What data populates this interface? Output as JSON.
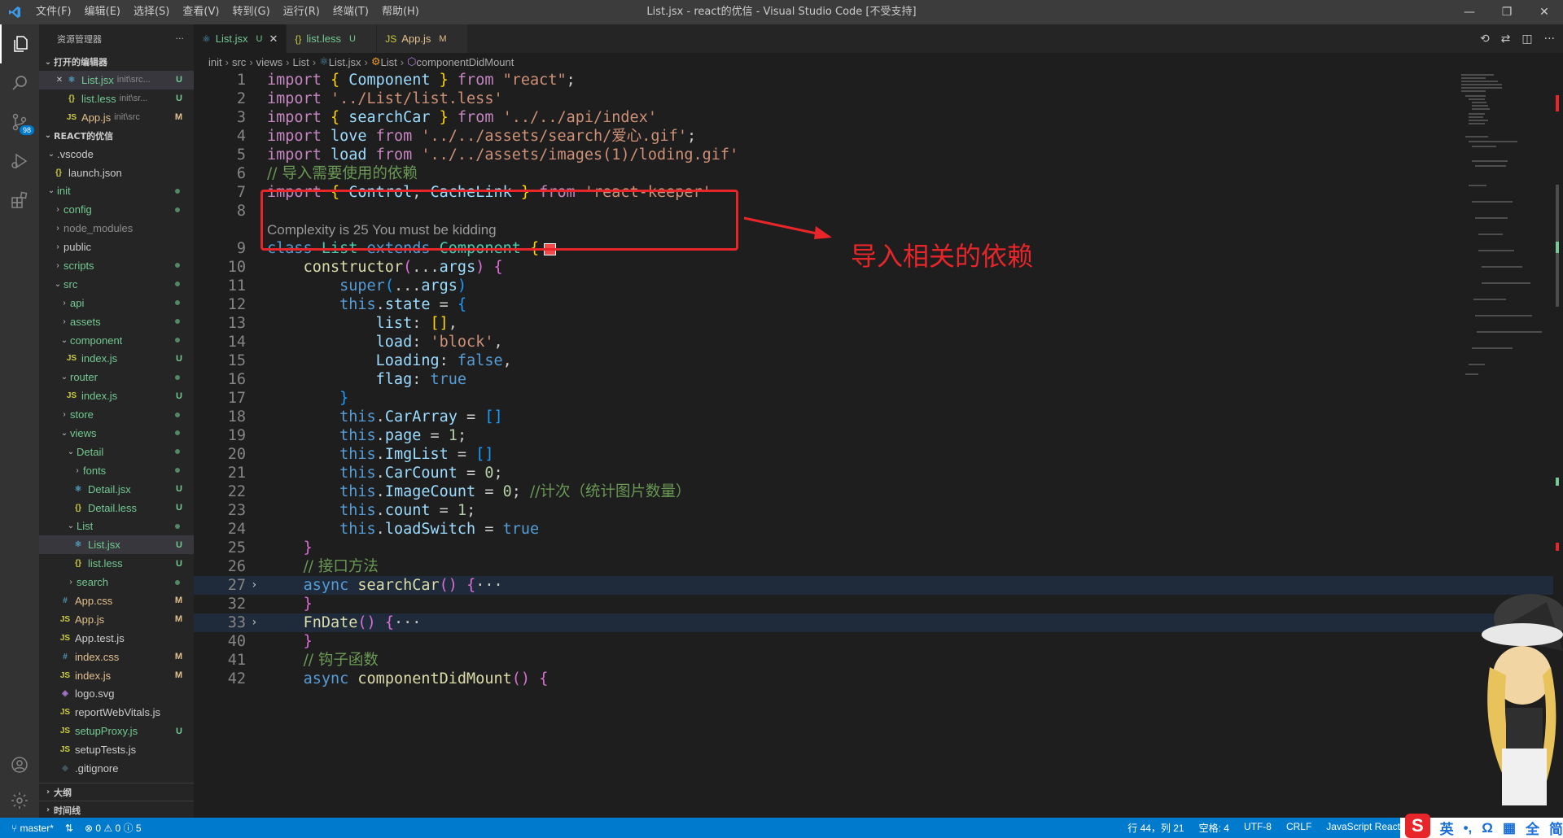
{
  "titlebar": {
    "title": "List.jsx - react的优信 - Visual Studio Code [不受支持]",
    "menu": [
      "文件(F)",
      "编辑(E)",
      "选择(S)",
      "查看(V)",
      "转到(G)",
      "运行(R)",
      "终端(T)",
      "帮助(H)"
    ],
    "minimize": "—",
    "maximize": "❐",
    "close": "✕"
  },
  "activity": {
    "scm_badge": "98"
  },
  "sidebar": {
    "header": "资源管理器",
    "more": "···",
    "open_editors_label": "打开的编辑器",
    "open_editors": [
      {
        "name": "List.jsx",
        "desc": "init\\src...",
        "status": "U",
        "icon": "⚛",
        "close": "✕"
      },
      {
        "name": "list.less",
        "desc": "init\\sr...",
        "status": "U",
        "icon": "{}"
      },
      {
        "name": "App.js",
        "desc": "init\\src",
        "status": "M",
        "icon": "JS"
      }
    ],
    "project_label": "REACT的优信",
    "tree": [
      {
        "name": ".vscode",
        "chev": "⌄",
        "depth": 1
      },
      {
        "name": "launch.json",
        "icon": "{}",
        "depth": 1
      },
      {
        "name": "init",
        "chev": "⌄",
        "depth": 1,
        "dot": true
      },
      {
        "name": "config",
        "chev": "›",
        "depth": 2,
        "dot": true
      },
      {
        "name": "node_modules",
        "chev": "›",
        "depth": 2,
        "gray": true
      },
      {
        "name": "public",
        "chev": "›",
        "depth": 2
      },
      {
        "name": "scripts",
        "chev": "›",
        "depth": 2,
        "dot": true
      },
      {
        "name": "src",
        "chev": "⌄",
        "depth": 2,
        "dot": true
      },
      {
        "name": "api",
        "chev": "›",
        "depth": 3,
        "dot": true
      },
      {
        "name": "assets",
        "chev": "›",
        "depth": 3,
        "dot": true
      },
      {
        "name": "component",
        "chev": "⌄",
        "depth": 3,
        "dot": true
      },
      {
        "name": "index.js",
        "icon": "JS",
        "depth": 3,
        "status": "U"
      },
      {
        "name": "router",
        "chev": "⌄",
        "depth": 3,
        "dot": true
      },
      {
        "name": "index.js",
        "icon": "JS",
        "depth": 3,
        "status": "U"
      },
      {
        "name": "store",
        "chev": "›",
        "depth": 3,
        "dot": true
      },
      {
        "name": "views",
        "chev": "⌄",
        "depth": 3,
        "dot": true
      },
      {
        "name": "Detail",
        "chev": "⌄",
        "depth": 4,
        "dot": true
      },
      {
        "name": "fonts",
        "chev": "›",
        "depth": 5,
        "dot": true
      },
      {
        "name": "Detail.jsx",
        "icon": "⚛",
        "depth": 4,
        "status": "U"
      },
      {
        "name": "Detail.less",
        "icon": "{}",
        "depth": 4,
        "status": "U"
      },
      {
        "name": "List",
        "chev": "⌄",
        "depth": 4,
        "dot": true
      },
      {
        "name": "List.jsx",
        "icon": "⚛",
        "depth": 4,
        "status": "U",
        "selected": true
      },
      {
        "name": "list.less",
        "icon": "{}",
        "depth": 4,
        "status": "U"
      },
      {
        "name": "search",
        "chev": "›",
        "depth": 4,
        "dot": true
      },
      {
        "name": "App.css",
        "icon": "#",
        "depth": 2,
        "status": "M"
      },
      {
        "name": "App.js",
        "icon": "JS",
        "depth": 2,
        "status": "M"
      },
      {
        "name": "App.test.js",
        "icon": "JS",
        "depth": 2
      },
      {
        "name": "index.css",
        "icon": "#",
        "depth": 2,
        "status": "M"
      },
      {
        "name": "index.js",
        "icon": "JS",
        "depth": 2,
        "status": "M"
      },
      {
        "name": "logo.svg",
        "icon": "◈",
        "depth": 2
      },
      {
        "name": "reportWebVitals.js",
        "icon": "JS",
        "depth": 2
      },
      {
        "name": "setupProxy.js",
        "icon": "JS",
        "depth": 2,
        "status": "U"
      },
      {
        "name": "setupTests.js",
        "icon": "JS",
        "depth": 2
      },
      {
        "name": ".gitignore",
        "icon": "◆",
        "depth": 2
      }
    ],
    "outline_label": "大纲",
    "timeline_label": "时间线"
  },
  "tabs": [
    {
      "name": "List.jsx",
      "status": "U",
      "icon": "⚛",
      "active": true,
      "close": "✕"
    },
    {
      "name": "list.less",
      "status": "U",
      "icon": "{}"
    },
    {
      "name": "App.js",
      "status": "M",
      "icon": "JS"
    }
  ],
  "breadcrumb": [
    "init",
    "src",
    "views",
    "List",
    "List.jsx",
    "List",
    "componentDidMount"
  ],
  "codelens": "Complexity is 25 You must be kidding",
  "annotation": "导入相关的依赖",
  "status": {
    "branch": "master*",
    "errors": "0",
    "warnings": "0",
    "info": "5",
    "position": "行 44，列 21",
    "spaces": "空格: 4",
    "encoding": "UTF-8",
    "eol": "CRLF",
    "language": "JavaScript React"
  },
  "ime": {
    "logo": "S",
    "items": [
      "英",
      "•,",
      "Ω",
      "▦",
      "全",
      "简"
    ]
  },
  "colors": {
    "accent": "#007acc",
    "annotation": "#e8262a",
    "modified": "#e2c08d",
    "untracked": "#73c991"
  }
}
